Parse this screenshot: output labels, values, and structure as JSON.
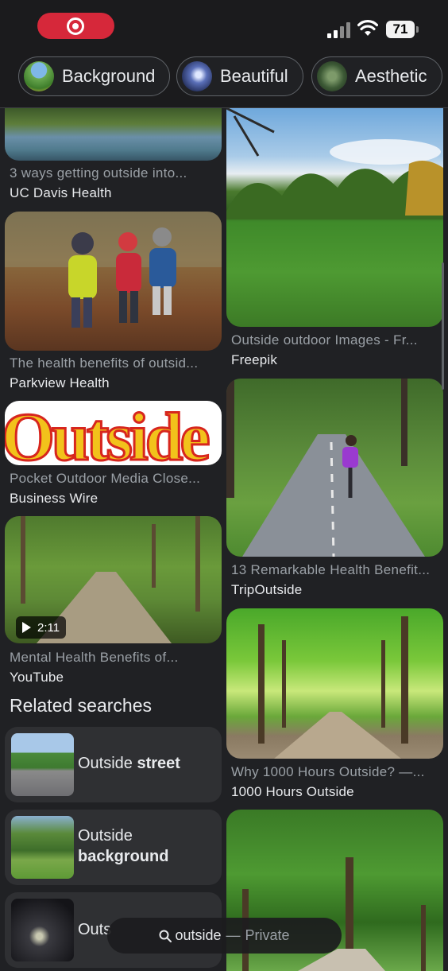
{
  "status_bar": {
    "battery": "71"
  },
  "chips": [
    {
      "label": "Background"
    },
    {
      "label": "Beautiful"
    },
    {
      "label": "Aesthetic"
    }
  ],
  "left_results": [
    {
      "title": "3 ways getting outside into...",
      "source": "UC Davis Health"
    },
    {
      "title": "The health benefits of outsid...",
      "source": "Parkview Health"
    },
    {
      "title": "Pocket Outdoor Media Close...",
      "source": "Business Wire",
      "logo_text": "Outside"
    },
    {
      "title": "Mental Health Benefits of...",
      "source": "YouTube",
      "video_duration": "2:11"
    }
  ],
  "right_results": [
    {
      "title": "Outside outdoor Images - Fr...",
      "source": "Freepik"
    },
    {
      "title": "13 Remarkable Health Benefit...",
      "source": "TripOutside"
    },
    {
      "title": "Why 1000 Hours Outside? —...",
      "source": "1000 Hours Outside"
    },
    {
      "title": "",
      "source": ""
    }
  ],
  "related": {
    "heading": "Related searches",
    "items": [
      {
        "prefix": "Outside ",
        "bold": "street"
      },
      {
        "prefix": "Outside",
        "bold": "background"
      },
      {
        "prefix": "Outs",
        "bold": ""
      }
    ]
  },
  "bottom_bar": {
    "query": "outside",
    "separator": "—",
    "mode": "Private"
  },
  "colors": {
    "background": "#202124",
    "record": "#d6283a",
    "card": "#2f3033",
    "muted_text": "#9aa0a6"
  }
}
